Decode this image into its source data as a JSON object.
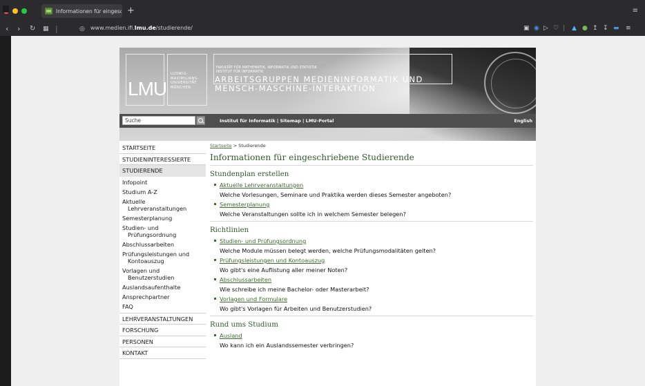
{
  "browser": {
    "tab_title": "Informationen für eingeschrie",
    "new_tab": "+",
    "url_prefix": "www.medien.ifi.",
    "url_domain": "lmu.de",
    "url_path": "/studierende/",
    "colors": {
      "chrome": "#2b2b2d",
      "close": "#fe5f57",
      "minimize": "#febc2e",
      "maximize": "#28c840"
    }
  },
  "header": {
    "logo_text": "LMU",
    "university_name": [
      "LUDWIG-",
      "MAXIMILIANS-",
      "UNIVERSITÄT",
      "MÜNCHEN"
    ],
    "faculty_line1": "FAKULTÄT FÜR MATHEMATIK, INFORMATIK UND STATISTIK",
    "faculty_line2": "INSTITUT FÜR INFORMATIK",
    "group_line1": "ARBEITSGRUPPEN MEDIENINFORMATIK UND",
    "group_line2": "MENSCH-MASCHINE-INTERAKTION",
    "search_value": "Suche",
    "links": "Institut für Informatik | Sitemap | LMU-Portal",
    "language": "English"
  },
  "nav": {
    "items": [
      {
        "label": "STARTSEITE"
      },
      {
        "label": "STUDIENINTERESSIERTE"
      },
      {
        "label": "STUDIERENDE"
      }
    ],
    "subitems": [
      "Infopoint",
      "Studium A-Z",
      "Aktuelle Lehrveranstaltungen",
      "Semesterplanung",
      "Studien- und Prüfungsordnung",
      "Abschlussarbeiten",
      "Prüfungsleistungen und Kontoauszug",
      "Vorlagen und Benutzerstudien",
      "Auslandsaufenthalte",
      "Ansprechpartner",
      "FAQ"
    ],
    "items_after": [
      {
        "label": "LEHRVERANSTALTUNGEN"
      },
      {
        "label": "FORSCHUNG"
      },
      {
        "label": "PERSONEN"
      },
      {
        "label": "KONTAKT"
      }
    ]
  },
  "content": {
    "breadcrumb_home": "Startseite",
    "breadcrumb_current": "> Studierende",
    "title": "Informationen für eingeschriebene Studierende",
    "sections": [
      {
        "heading": "Stundenplan erstellen",
        "entries": [
          {
            "link": "Aktuelle Lehrveranstaltungen",
            "desc": "Welche Vorlesungen, Seminare und Praktika werden dieses Semester angeboten?"
          },
          {
            "link": "Semesterplanung",
            "desc": "Welche Veranstaltungen sollte ich in welchem Semester belegen?"
          }
        ]
      },
      {
        "heading": "Richtlinien",
        "entries": [
          {
            "link": "Studien- und Prüfungsordnung",
            "desc": "Welche Module müssen belegt werden, welche Prüfungsmodalitäten gelten?"
          },
          {
            "link": "Prüfungsleistungen und Kontoauszug",
            "desc": "Wo gibt's eine Auflistung aller meiner Noten?"
          },
          {
            "link": "Abschlussarbeiten",
            "desc": "Wie schreibe ich meine Bachelor- oder Masterarbeit?"
          },
          {
            "link": "Vorlagen und Formulare",
            "desc": "Wo gibt's Vorlagen für Arbeiten und Benutzerstudien?"
          }
        ]
      },
      {
        "heading": "Rund ums Studium",
        "entries": [
          {
            "link": "Ausland",
            "desc": "Wo kann ich ein Auslandssemester verbringen?"
          }
        ]
      }
    ]
  }
}
